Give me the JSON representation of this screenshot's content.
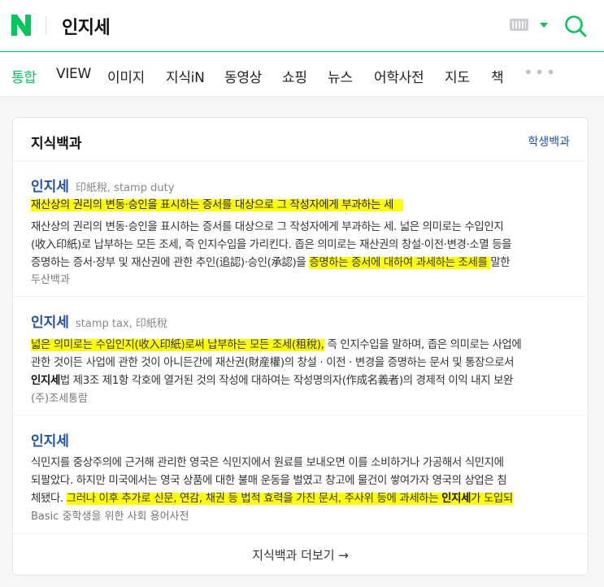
{
  "header": {
    "query": "인지세",
    "logo_letter": "N",
    "colors": {
      "brand": "#03c75a",
      "link": "#2151a8",
      "highlight": "#ffff00"
    }
  },
  "tabs": [
    {
      "label": "통합",
      "active": true
    },
    {
      "label": "VIEW"
    },
    {
      "label": "이미지"
    },
    {
      "label": "지식iN"
    },
    {
      "label": "동영상"
    },
    {
      "label": "쇼핑"
    },
    {
      "label": "뉴스"
    },
    {
      "label": "어학사전"
    },
    {
      "label": "지도"
    },
    {
      "label": "책"
    },
    {
      "label": "•••"
    }
  ],
  "card": {
    "title": "지식백과",
    "link": "학생백과",
    "more": "지식백과 더보기 →",
    "entries": [
      {
        "title": "인지세",
        "sub": "印紙稅, stamp duty",
        "lead": "재산상의 권리의 변동·승인을 표시하는 증서를 대상으로 그 작성자에게 부과하는 세",
        "l1": "재산상의 권리의 변동·승인을 표시하는 증서를 대상으로 그 작성자에게 부과하는 세. 넓은 의미로는 수입인지",
        "l2": "(收入印紙)로 납부하는 모든 조세, 즉 인지수입을 가리킨다. 좁은 의미로는 재산권의 창설·이전·변경·소멸 등을",
        "l3a": "증명하는 증서·장부 및 재산권에 관한 추인(追認)·승인(承認)을 ",
        "l3b": "증명하는 증서에 대하여 과세하는 조세를 ",
        "l3c": "말한",
        "source": "두산백과"
      },
      {
        "title": "인지세",
        "sub": "stamp tax, 印紙稅",
        "l1a": "넓은 의미로는 수입인지(收入印紙)로써 납부하는 모든 조세(租稅),",
        "l1b": " 즉 인지수입을 말하며, 좁은 의미로는 사업에",
        "l2": "관한 것이든 사업에 관한 것이 아니든간에 재산권(財産權)의 창설 · 이전 · 변경을 증명하는 문서 및 통장으로서",
        "l3a": "인지세",
        "l3b": "법 제3조 제1항 각호에 열거된 것의 작성에 대하여는 작성명의자(作成名義者)의 경제적 이익 내지 보완",
        "source": "(주)조세통람"
      },
      {
        "title": "인지세",
        "l1": "식민지를 중상주의에 근거해 관리한 영국은 식민지에서 원료를 보내오면 이를 소비하거나 가공해서 식민지에",
        "l2": "되팔았다. 하지만 미국에서는 영국 상품에 대한 불매 운동을 벌였고 창고에 물건이 쌓여가자 영국의 상업은 침",
        "l3a": "체됐다. ",
        "l3b": "그러나 이후 추가로 신문, 연감, 채권 등 법적 효력을 가진 문서, 주사위 등에 과세하는 ",
        "l3c": "인지세",
        "l3d": "가 도입되",
        "source": "Basic 중학생을 위한 사회 용어사전"
      }
    ]
  }
}
